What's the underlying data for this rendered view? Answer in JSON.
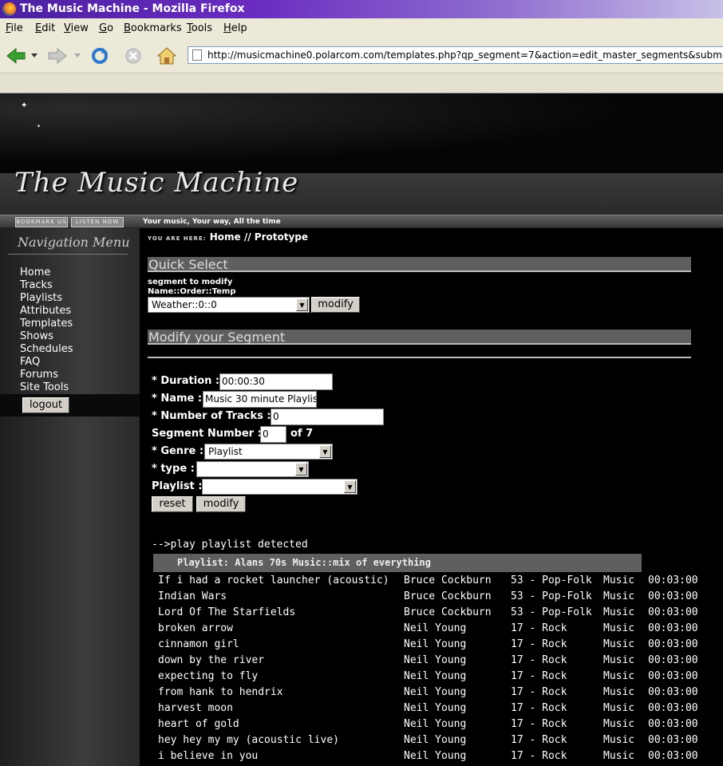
{
  "window": {
    "title": "The Music Machine - Mozilla Firefox"
  },
  "menu": [
    "File",
    "Edit",
    "View",
    "Go",
    "Bookmarks",
    "Tools",
    "Help"
  ],
  "address": {
    "url": "http://musicmachine0.polarcom.com/templates.php?qp_segment=7&action=edit_master_segments&submit=mo"
  },
  "site": {
    "logo": "The Music Machine",
    "strip_buttons": {
      "bookmark": "BOOKMARK US",
      "listen": "LISTEN NOW"
    },
    "tagline": "Your music, Your way, All the time"
  },
  "sidebar": {
    "title": "Navigation Menu",
    "items": [
      "Home",
      "Tracks",
      "Playlists",
      "Attributes",
      "Templates",
      "Shows",
      "Schedules",
      "FAQ",
      "Forums",
      "Site Tools"
    ],
    "logout": "logout"
  },
  "breadcrumb": {
    "prefix": "YOU ARE HERE:",
    "path": "Home // Prototype"
  },
  "quick_select": {
    "title": "Quick Select",
    "label": "segment to modify",
    "sublabel": "Name::Order::Temp",
    "selected": "Weather::0::0",
    "button": "modify"
  },
  "modify": {
    "title": "Modify your Segment",
    "duration_label": "* Duration :",
    "duration": "00:00:30",
    "name_label": "* Name :",
    "name": "Music 30 minute Playlis",
    "tracks_label": "* Number of Tracks :",
    "tracks": "0",
    "segnum_label": "Segment Number :",
    "segnum": "0",
    "segnum_of": "of 7",
    "genre_label": "* Genre :",
    "genre": "Playlist",
    "type_label": "* type :",
    "type": "",
    "playlist_label": "Playlist :",
    "playlist": "",
    "reset": "reset",
    "submit": "modify"
  },
  "playlist": {
    "detected": "-->play playlist detected",
    "header": "Playlist: Alans 70s Music::mix of everything",
    "tracks": [
      {
        "title": "If i had a rocket launcher (acoustic)",
        "artist": "Bruce Cockburn",
        "genre": "53 - Pop-Folk",
        "type": "Music",
        "duration": "00:03:00"
      },
      {
        "title": "Indian Wars",
        "artist": "Bruce Cockburn",
        "genre": "53 - Pop-Folk",
        "type": "Music",
        "duration": "00:03:00"
      },
      {
        "title": "Lord Of The Starfields",
        "artist": "Bruce Cockburn",
        "genre": "53 - Pop-Folk",
        "type": "Music",
        "duration": "00:03:00"
      },
      {
        "title": "broken arrow",
        "artist": "Neil Young",
        "genre": "17 - Rock",
        "type": "Music",
        "duration": "00:03:00"
      },
      {
        "title": "cinnamon girl",
        "artist": "Neil Young",
        "genre": "17 - Rock",
        "type": "Music",
        "duration": "00:03:00"
      },
      {
        "title": "down by the river",
        "artist": "Neil Young",
        "genre": "17 - Rock",
        "type": "Music",
        "duration": "00:03:00"
      },
      {
        "title": "expecting to fly",
        "artist": "Neil Young",
        "genre": "17 - Rock",
        "type": "Music",
        "duration": "00:03:00"
      },
      {
        "title": "from hank to hendrix",
        "artist": "Neil Young",
        "genre": "17 - Rock",
        "type": "Music",
        "duration": "00:03:00"
      },
      {
        "title": "harvest moon",
        "artist": "Neil Young",
        "genre": "17 - Rock",
        "type": "Music",
        "duration": "00:03:00"
      },
      {
        "title": "heart of gold",
        "artist": "Neil Young",
        "genre": "17 - Rock",
        "type": "Music",
        "duration": "00:03:00"
      },
      {
        "title": "hey hey my my (acoustic live)",
        "artist": "Neil Young",
        "genre": "17 - Rock",
        "type": "Music",
        "duration": "00:03:00"
      },
      {
        "title": "i believe in you",
        "artist": "Neil Young",
        "genre": "17 - Rock",
        "type": "Music",
        "duration": "00:03:00"
      }
    ]
  },
  "colors": {
    "title_bar": "#6a2cc0",
    "chrome": "#ece9d8",
    "section_bar": "#5f5f5f",
    "page_bg": "#000000"
  }
}
